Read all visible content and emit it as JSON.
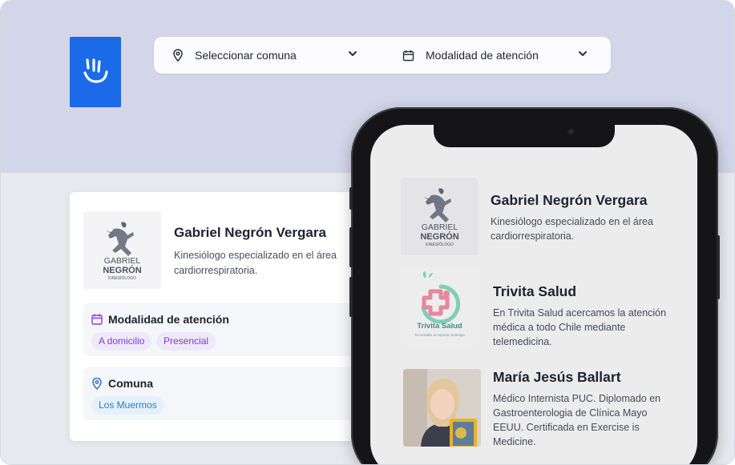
{
  "filters": {
    "comuna_placeholder": "Seleccionar comuna",
    "modalidad_placeholder": "Modalidad de atención"
  },
  "brand": {
    "accent": "#1b6be8",
    "logo_icon": "hand-wave-icon"
  },
  "card": {
    "name": "Gabriel Negrón Vergara",
    "description": "Kinesiólogo especializado en el área cardiorrespiratoria.",
    "logo_text": {
      "line1": "GABRIEL",
      "line2": "NEGRÓN",
      "line3": "KINESIÓLOGO"
    },
    "modalidad": {
      "title": "Modalidad de atención",
      "options": [
        "A domicilio",
        "Presencial"
      ]
    },
    "comuna": {
      "title": "Comuna",
      "options": [
        "Los Muermos"
      ]
    }
  },
  "phone": {
    "items": [
      {
        "name": "Gabriel Negrón Vergara",
        "description": "Kinesiólogo especializado en el área cardiorrespiratoria.",
        "logo_text": {
          "line1": "GABRIEL",
          "line2": "NEGRÓN",
          "line3": "KINESIÓLOGO"
        }
      },
      {
        "name": "Trivita Salud",
        "description": "En Trivita Salud acercamos la atención médica a todo Chile mediante telemedicina.",
        "logo_text": {
          "brand": "Trivita Salud",
          "tagline": "Tu consulta, tu espacio, tu tiempo"
        }
      },
      {
        "name": "María Jesús Ballart",
        "description": "Médico Internista PUC. Diplomado en Gastroenterologia de Clínica Mayo EEUU. Certificada en Exercise is Medicine."
      }
    ]
  }
}
